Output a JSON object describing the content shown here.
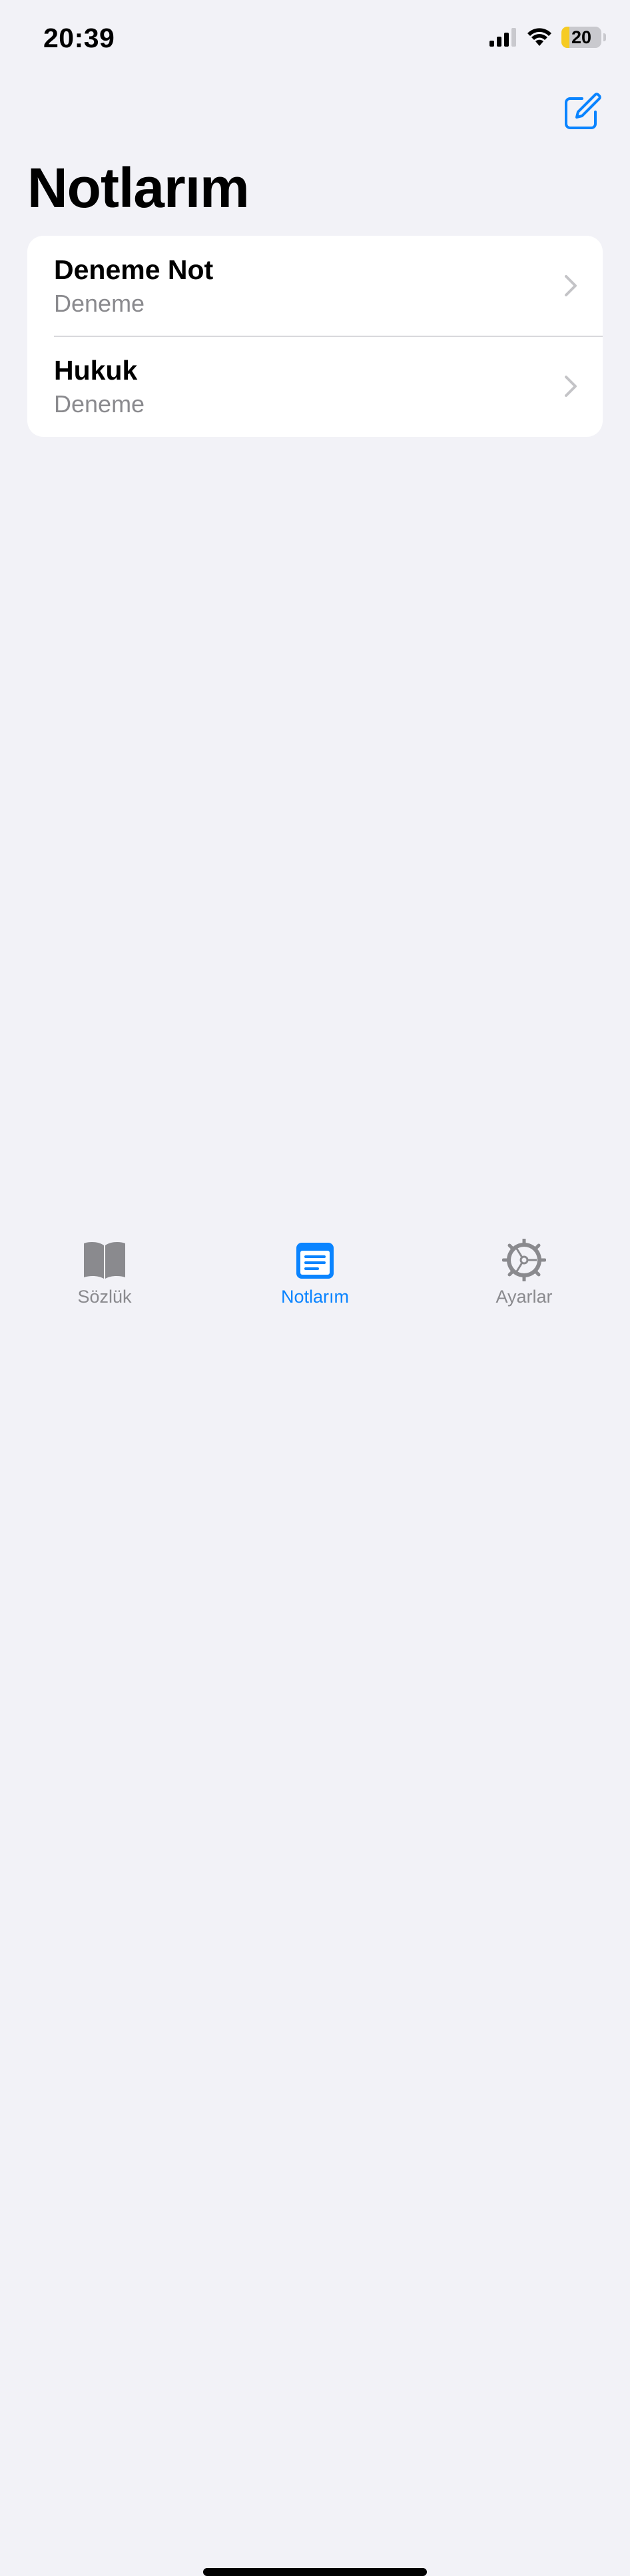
{
  "status_bar": {
    "time": "20:39",
    "battery_level": "20",
    "battery_percent": 20,
    "battery_color": "#f6cb22",
    "icons": [
      "signal-icon",
      "wifi-icon",
      "battery-icon"
    ]
  },
  "header": {
    "title": "Notlarım",
    "compose_icon": "compose-icon"
  },
  "notes": [
    {
      "title": "Deneme Not",
      "subtitle": "Deneme"
    },
    {
      "title": "Hukuk",
      "subtitle": "Deneme"
    }
  ],
  "tab_bar": {
    "items": [
      {
        "label": "Sözlük",
        "icon": "book-icon",
        "active": false
      },
      {
        "label": "Notlarım",
        "icon": "notes-icon",
        "active": true
      },
      {
        "label": "Ayarlar",
        "icon": "gear-icon",
        "active": false
      }
    ]
  },
  "colors": {
    "accent": "#0a84ff",
    "background": "#f2f2f7",
    "secondary_text": "#8a8a8e",
    "inactive_tab": "#8a8a8e"
  }
}
